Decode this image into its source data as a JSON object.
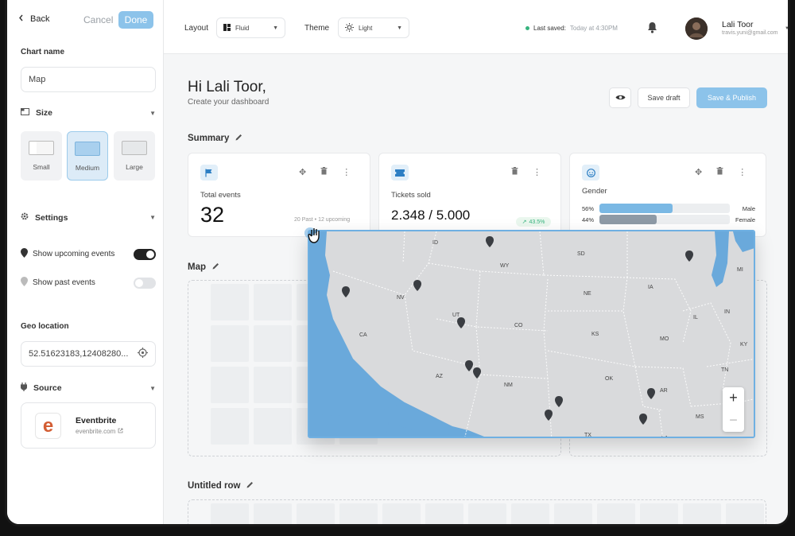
{
  "sidebar": {
    "back_label": "Back",
    "cancel_label": "Cancel",
    "done_label": "Done",
    "chart_name_label": "Chart name",
    "chart_name_value": "Map",
    "size_label": "Size",
    "size_options": [
      {
        "label": "Small"
      },
      {
        "label": "Medium",
        "selected": true
      },
      {
        "label": "Large"
      }
    ],
    "settings_label": "Settings",
    "show_upcoming_label": "Show upcoming events",
    "show_upcoming_on": true,
    "show_past_label": "Show past events",
    "show_past_on": false,
    "geo_label": "Geo location",
    "geo_value": "52.51623183,12408280...",
    "source_label": "Source",
    "source_name": "Eventbrite",
    "source_url": "evenbrite.com",
    "source_logo": "e"
  },
  "topbar": {
    "layout_label": "Layout",
    "layout_value": "Fluid",
    "theme_label": "Theme",
    "theme_value": "Light",
    "last_saved_label": "Last saved:",
    "last_saved_time": "Today at 4:30PM",
    "user_name": "Lali Toor",
    "user_email": "travis.yuni@gmail.com"
  },
  "main": {
    "greeting": "Hi Lali Toor,",
    "subtitle": "Create your dashboard",
    "save_draft_label": "Save draft",
    "publish_label": "Save & Publish",
    "summary_title": "Summary",
    "map_title": "Map",
    "untitled_title": "Untitled row",
    "cards": {
      "events": {
        "title": "Total events",
        "value": "32",
        "note": "20 Past • 12 upcoming"
      },
      "tickets": {
        "title": "Tickets sold",
        "value": "2.348 / 5.000",
        "delta": "43.5%"
      },
      "gender": {
        "title": "Gender",
        "rows": [
          {
            "pct_label": "56%",
            "label": "Male",
            "value": 0.56,
            "color": "#7ab8e4"
          },
          {
            "pct_label": "44%",
            "label": "Female",
            "value": 0.44,
            "color": "#8e9aa6"
          }
        ]
      }
    }
  },
  "map": {
    "state_labels": [
      "ID",
      "WY",
      "SD",
      "NV",
      "UT",
      "CO",
      "NE",
      "IA",
      "CA",
      "KS",
      "AZ",
      "NM",
      "OK",
      "MO",
      "IL",
      "IN",
      "KY",
      "TN",
      "AR",
      "MS",
      "TX",
      "LA",
      "MI"
    ],
    "water_color": "#6aa9db",
    "land_color": "#d9dadc",
    "marker_count": 11,
    "zoom_in": "+",
    "zoom_out": "−"
  },
  "colors": {
    "accent": "#8cc3ea",
    "success": "#36b37e"
  }
}
